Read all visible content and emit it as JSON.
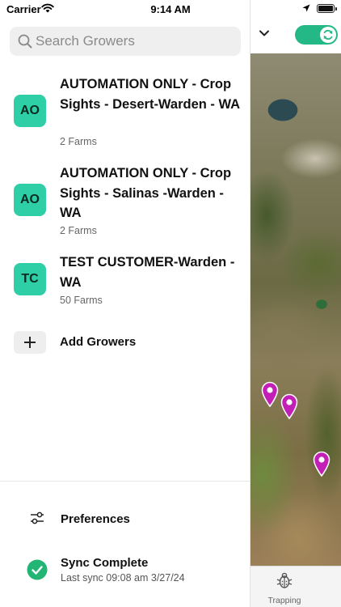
{
  "status_bar": {
    "carrier": "Carrier",
    "time": "9:14 AM"
  },
  "search": {
    "placeholder": "Search Growers"
  },
  "growers": [
    {
      "initials": "AO",
      "name": "AUTOMATION ONLY - Crop Sights - Desert-Warden - WA",
      "farms": "2 Farms"
    },
    {
      "initials": "AO",
      "name": "AUTOMATION ONLY - Crop Sights - Salinas -Warden - WA",
      "farms": "2 Farms"
    },
    {
      "initials": "TC",
      "name": "TEST CUSTOMER-Warden - WA",
      "farms": "50 Farms"
    }
  ],
  "add_growers": {
    "label": "Add Growers"
  },
  "preferences": {
    "label": "Preferences"
  },
  "sync": {
    "status": "Sync Complete",
    "last_sync": "Last sync 09:08 am 3/27/24"
  },
  "map": {
    "tab_label": "Trapping",
    "sync_toggle_on": true
  },
  "colors": {
    "avatar": "#2ecfa6",
    "toggle": "#24b886",
    "sync_check": "#22b573",
    "pin": "#c21fb6"
  },
  "icons": {
    "search": "search-icon",
    "add": "plus-icon",
    "preferences": "sliders-icon",
    "sync": "check-circle-icon",
    "trapping": "bug-icon",
    "chevron": "chevron-down-icon",
    "toggle_knob": "refresh-icon",
    "pin": "map-pin-icon"
  }
}
